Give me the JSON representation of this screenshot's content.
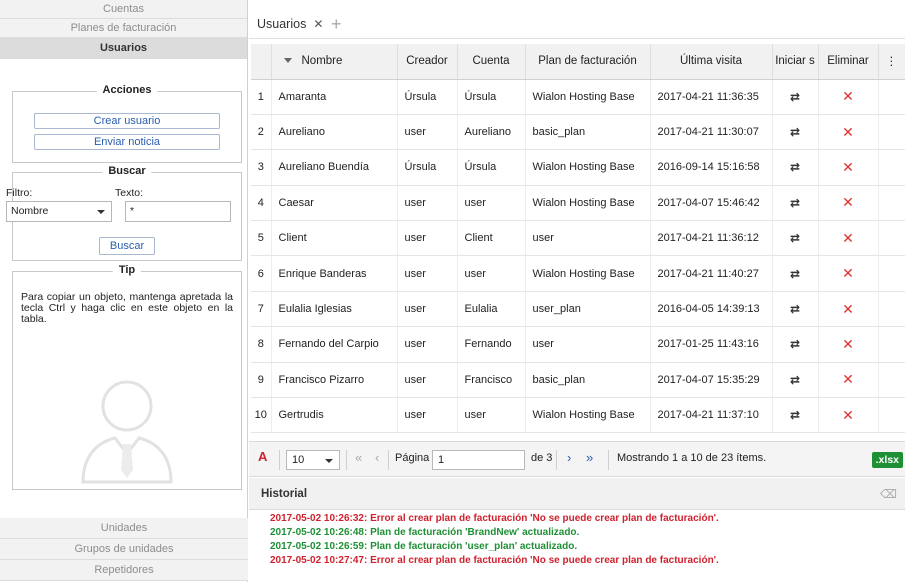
{
  "sidebar": {
    "nav_top": [
      "Cuentas",
      "Planes de facturación",
      "Usuarios"
    ],
    "actions": {
      "legend": "Acciones",
      "create_user": "Crear usuario",
      "send_notice": "Enviar noticia"
    },
    "search": {
      "legend": "Buscar",
      "filter_label": "Filtro:",
      "text_label": "Texto:",
      "filter_value": "Nombre",
      "text_value": "*",
      "button": "Buscar"
    },
    "tip": {
      "legend": "Tip",
      "text": "Para copiar un objeto, mantenga apretada la tecla Ctrl y haga clic en este objeto en la tabla."
    },
    "nav_bottom": [
      "Unidades",
      "Grupos de unidades",
      "Repetidores"
    ]
  },
  "tab": {
    "label": "Usuarios",
    "close": "✕",
    "add": "+"
  },
  "table": {
    "columns": [
      "",
      "Nombre",
      "Creador",
      "Cuenta",
      "Plan de facturación",
      "Última visita",
      "Iniciar s",
      "Eliminar",
      "⋮"
    ],
    "rows": [
      [
        "1",
        "Amaranta",
        "Úrsula",
        "Úrsula",
        "Wialon Hosting Base",
        "2017-04-21 11:36:35"
      ],
      [
        "2",
        "Aureliano",
        "user",
        "Aureliano",
        "basic_plan",
        "2017-04-21 11:30:07"
      ],
      [
        "3",
        "Aureliano Buendía",
        "Úrsula",
        "Úrsula",
        "Wialon Hosting Base",
        "2016-09-14 15:16:58"
      ],
      [
        "4",
        "Caesar",
        "user",
        "user",
        "Wialon Hosting Base",
        "2017-04-07 15:46:42"
      ],
      [
        "5",
        "Client",
        "user",
        "Client",
        "user",
        "2017-04-21 11:36:12"
      ],
      [
        "6",
        "Enrique Banderas",
        "user",
        "user",
        "Wialon Hosting Base",
        "2017-04-21 11:40:27"
      ],
      [
        "7",
        "Eulalia Iglesias",
        "user",
        "Eulalia",
        "user_plan",
        "2016-04-05 14:39:13"
      ],
      [
        "8",
        "Fernando del Carpio",
        "user",
        "Fernando",
        "user",
        "2017-01-25 11:43:16"
      ],
      [
        "9",
        "Francisco Pizarro",
        "user",
        "Francisco",
        "basic_plan",
        "2017-04-07 15:35:29"
      ],
      [
        "10",
        "Gertrudis",
        "user",
        "user",
        "Wialon Hosting Base",
        "2017-04-21 11:37:10"
      ]
    ],
    "login_icon": "⇄",
    "delete_icon": "✕"
  },
  "pager": {
    "page_size": "10",
    "page_label": "Página",
    "page_value": "1",
    "of_label": "de 3",
    "showing": "Mostrando 1 a 10 de 23 ítems.",
    "export": ".xlsx"
  },
  "history": {
    "title": "Historial",
    "lines": [
      {
        "text": "2017-05-02 10:26:32: Error al crear plan de facturación 'No se puede crear plan de facturación'.",
        "color": "#d0222e"
      },
      {
        "text": "2017-05-02 10:26:48: Plan de facturación 'BrandNew' actualizado.",
        "color": "#1f8f35"
      },
      {
        "text": "2017-05-02 10:26:59: Plan de facturación 'user_plan' actualizado.",
        "color": "#1f8f35"
      },
      {
        "text": "2017-05-02 10:27:47: Error al crear plan de facturación 'No se puede crear plan de facturación'.",
        "color": "#d0222e"
      }
    ]
  }
}
